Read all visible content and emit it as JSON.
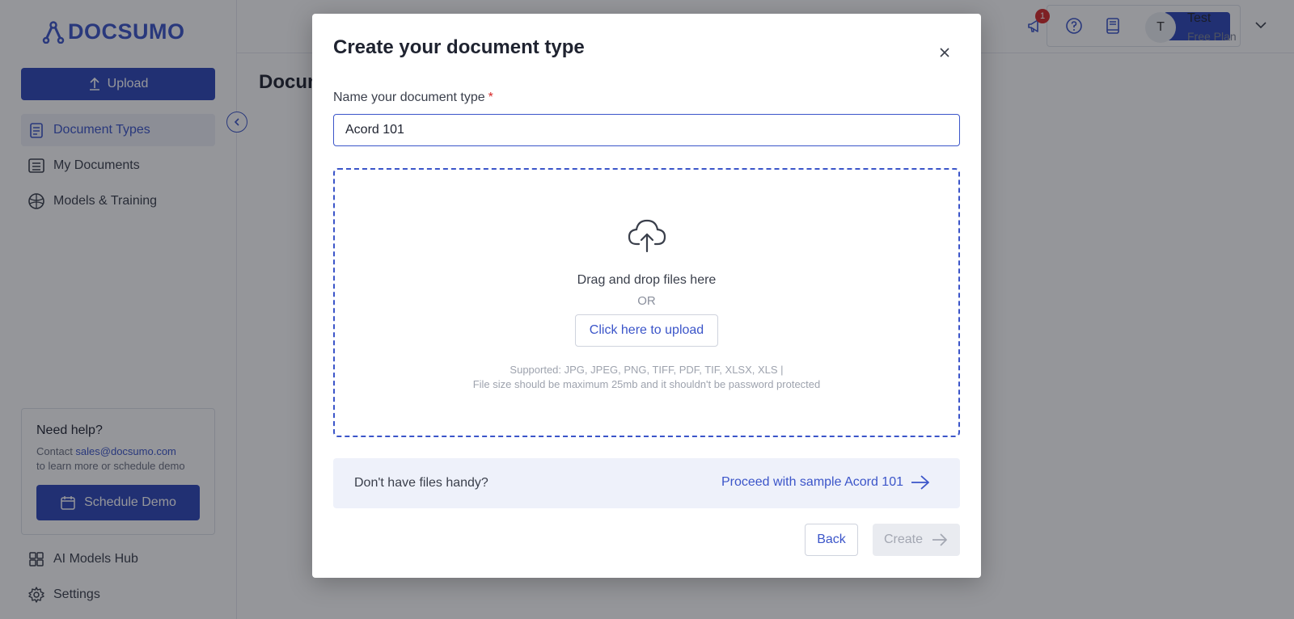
{
  "app": {
    "logo_text": "DOCSUMO",
    "upload_label": "Upload",
    "page_title": "Docum",
    "nav": [
      {
        "label": "Document Types",
        "icon": "document-types-icon",
        "active": true
      },
      {
        "label": "My Documents",
        "icon": "my-documents-icon",
        "active": false
      },
      {
        "label": "Models & Training",
        "icon": "models-icon",
        "active": false
      }
    ],
    "help": {
      "title": "Need help?",
      "contact_prefix": "Contact ",
      "email": "sales@docsumo.com",
      "text": "to learn more or schedule demo",
      "demo_label": "Schedule Demo"
    },
    "bottom_nav": [
      {
        "label": "AI Models Hub",
        "icon": "grid-icon"
      },
      {
        "label": "Settings",
        "icon": "gear-icon"
      }
    ],
    "topbar": {
      "notification_count": "1",
      "avatar_initial": "T",
      "user_name": "Test",
      "user_plan": "Free Plan"
    }
  },
  "modal": {
    "title": "Create your document type",
    "name_label": "Name your document type",
    "required_mark": "*",
    "name_value": "Acord 101",
    "dropzone": {
      "drag_text": "Drag and drop files here",
      "or_text": "OR",
      "upload_button": "Click here to upload",
      "supported": "Supported: JPG, JPEG, PNG, TIFF, PDF, TIF, XLSX, XLS |",
      "file_size": "File size should be maximum 25mb and it shouldn't be password protected"
    },
    "sample": {
      "question": "Don't have files handy?",
      "link": "Proceed with sample Acord 101"
    },
    "back_label": "Back",
    "create_label": "Create"
  },
  "colors": {
    "brand": "#2d46b9",
    "link": "#3b55c9",
    "alert": "#d62828"
  }
}
